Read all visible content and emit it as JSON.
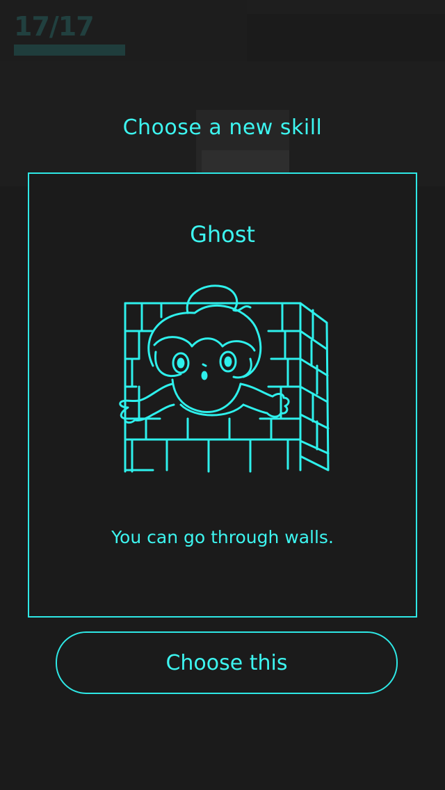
{
  "hud": {
    "progress_label": "17/17",
    "progress_fraction": 1.0
  },
  "modal": {
    "title": "Choose a new skill",
    "skill": {
      "name": "Ghost",
      "illustration": "ghost-in-wall-icon",
      "description": "You can go through walls."
    },
    "choose_button_label": "Choose this"
  },
  "colors": {
    "background": "#1b1b1b",
    "accent": "#3df5f0",
    "border": "#2ee8e6",
    "hud_dim": "#21403f"
  }
}
